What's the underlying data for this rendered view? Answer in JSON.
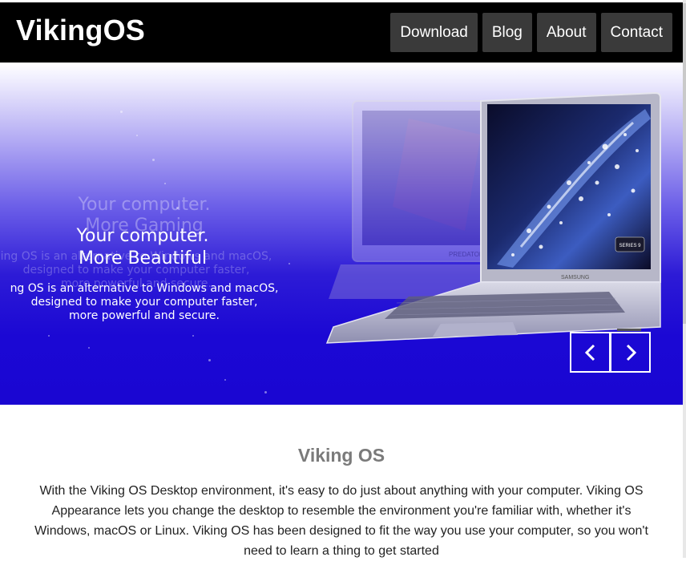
{
  "navbar": {
    "brand": "VikingOS",
    "items": [
      {
        "label": "Download"
      },
      {
        "label": "Blog"
      },
      {
        "label": "About"
      },
      {
        "label": "Contact"
      }
    ]
  },
  "hero": {
    "ghost_title": [
      "Your computer.",
      "More Gaming"
    ],
    "title": [
      "Your computer.",
      "More Beautiful"
    ],
    "ghost_description": [
      "ing OS is an alternative to Windows and macOS,",
      "designed to make your computer faster,",
      "more powerful and secure."
    ],
    "description": [
      "ng OS is an alternative to Windows and macOS,",
      "designed to make your computer faster,",
      "more powerful and secure."
    ],
    "laptop_logo": "SAMSUNG",
    "laptop_badge": "SERIES 9",
    "ghost_laptop_label": "PREDATOR",
    "prev_icon": "chevron-left-icon",
    "next_icon": "chevron-right-icon"
  },
  "section": {
    "title": "Viking OS",
    "body": "With the Viking OS Desktop environment, it's easy to do just about anything with your computer. Viking OS Appearance lets you change the desktop to resemble the environment you're familiar with, whether it's Windows, macOS or Linux. Viking OS has been designed to fit the way you use your computer, so you won't need to learn a thing to get started"
  },
  "colors": {
    "navbar_bg": "#000000",
    "nav_button_bg": "#3a3a3a",
    "hero_blue": "#1a06d2",
    "section_title": "#7a7a7a"
  }
}
